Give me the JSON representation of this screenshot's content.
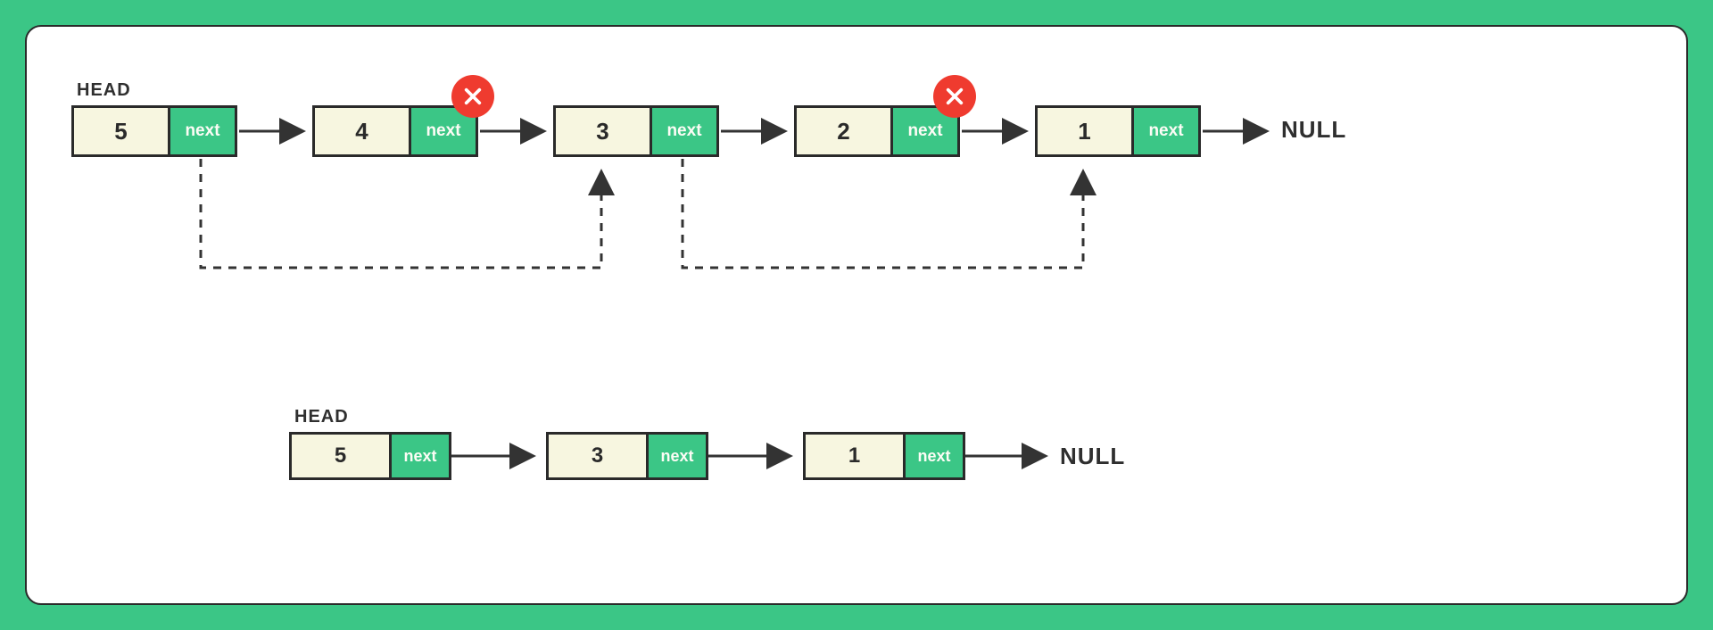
{
  "labels": {
    "head": "HEAD",
    "null": "NULL",
    "next": "next"
  },
  "topNodes": {
    "n1": "5",
    "n2": "4",
    "n3": "3",
    "n4": "2",
    "n5": "1"
  },
  "deletedNodes": [
    "4",
    "2"
  ],
  "bottomNodes": {
    "b1": "5",
    "b2": "3",
    "b3": "1"
  },
  "colors": {
    "accent": "#3bc686",
    "cream": "#f7f6e0",
    "stroke": "#2a2a2a",
    "badge": "#ef3b2f"
  }
}
